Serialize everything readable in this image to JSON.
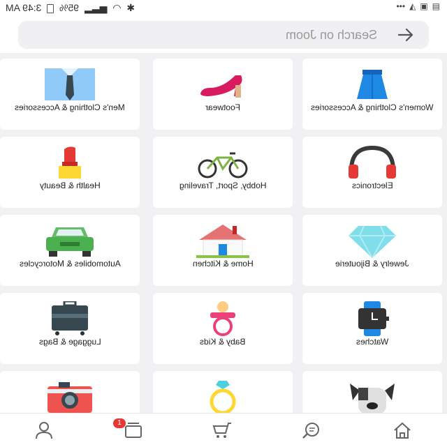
{
  "status_bar": {
    "time": "3:49 AM",
    "battery": "95%"
  },
  "search": {
    "placeholder": "Search on Joom"
  },
  "categories": [
    {
      "label": "Women's Clothing & Accessories",
      "icon": "skirt-icon"
    },
    {
      "label": "Footwear",
      "icon": "high-heel-icon"
    },
    {
      "label": "Men's Clothing & Accessories",
      "icon": "shirt-tie-icon"
    },
    {
      "label": "Electronics",
      "icon": "headphones-icon"
    },
    {
      "label": "Hobby, Sport, Traveling",
      "icon": "bicycle-icon"
    },
    {
      "label": "Health & Beauty",
      "icon": "lipstick-icon"
    },
    {
      "label": "Jewelry & Bijouterie",
      "icon": "diamond-icon"
    },
    {
      "label": "Home & Kitchen",
      "icon": "house-icon"
    },
    {
      "label": "Automobiles & Motorcycles",
      "icon": "car-icon"
    },
    {
      "label": "Watches",
      "icon": "watch-icon"
    },
    {
      "label": "Baby & Kids",
      "icon": "pacifier-icon"
    },
    {
      "label": "Luggage & Bags",
      "icon": "luggage-icon"
    },
    {
      "label": "",
      "icon": "dog-icon"
    },
    {
      "label": "",
      "icon": "ring-icon"
    },
    {
      "label": "",
      "icon": "camera-icon"
    }
  ],
  "bottom_nav": {
    "items": [
      "home-icon",
      "search-feed-icon",
      "cart-icon",
      "notifications-icon",
      "profile-icon"
    ],
    "badge": "1"
  }
}
